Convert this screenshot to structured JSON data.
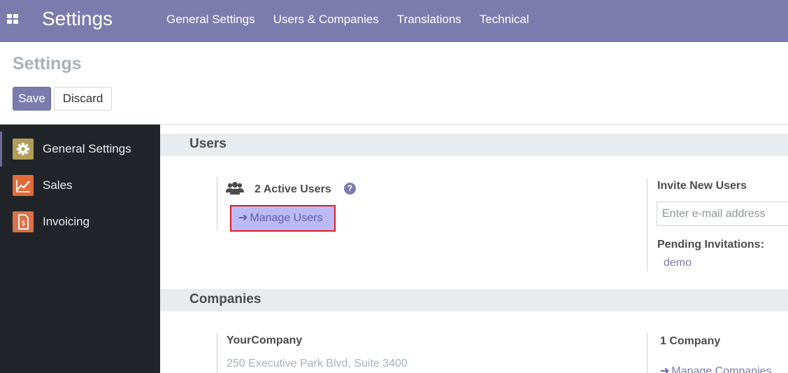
{
  "navbar": {
    "app_title": "Settings",
    "menu": [
      {
        "label": "General Settings"
      },
      {
        "label": "Users & Companies"
      },
      {
        "label": "Translations"
      },
      {
        "label": "Technical"
      }
    ]
  },
  "control_panel": {
    "title": "Settings",
    "save_label": "Save",
    "discard_label": "Discard"
  },
  "sidebar": {
    "items": [
      {
        "label": "General Settings",
        "icon": "gear-icon",
        "color": "#b29e5a"
      },
      {
        "label": "Sales",
        "icon": "chart-line-icon",
        "color": "#e06c3b"
      },
      {
        "label": "Invoicing",
        "icon": "invoice-icon",
        "color": "#d8724a"
      }
    ]
  },
  "users_section": {
    "title": "Users",
    "active_users": "2 Active Users",
    "help_glyph": "?",
    "manage_users": "Manage Users",
    "invite_title": "Invite New Users",
    "email_placeholder": "Enter e-mail address",
    "pending_title": "Pending Invitations:",
    "pending": [
      "demo"
    ]
  },
  "companies_section": {
    "title": "Companies",
    "company_name": "YourCompany",
    "company_address": "250 Executive Park Blvd, Suite 3400",
    "company_count": "1 Company",
    "manage_companies": "Manage Companies"
  },
  "colors": {
    "brand": "#7c7bad",
    "highlight_border": "#e01b24",
    "highlight_fill": "#bcbaf5"
  }
}
